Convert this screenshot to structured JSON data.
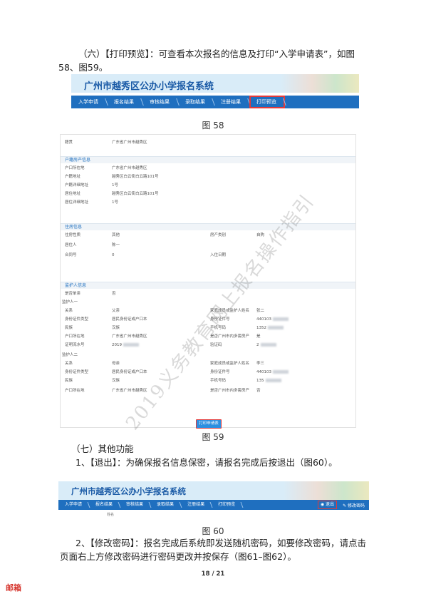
{
  "para1": "（六）【打印预览】：可查看本次报名的信息及打印“入学申请表”，如图58、图59。",
  "system_title": "广州市越秀区公办小学报名系统",
  "nav_items": [
    "入学申请",
    "报名结果",
    "审核结果",
    "录取结果",
    "注册结果",
    "打印预览"
  ],
  "fig58": "图 58",
  "form": {
    "top_row": {
      "label": "籍贯",
      "value": "广东省广州市越秀区"
    },
    "sections": [
      {
        "title": "户籍房产信息",
        "rows": [
          [
            "户口所在地",
            "广东省广州市越秀区",
            "",
            ""
          ],
          [
            "户籍地址",
            "越秀区白云街白云路101号",
            "",
            ""
          ],
          [
            "户籍详细地址",
            "1号",
            "",
            ""
          ],
          [
            "居住地址",
            "越秀区白云街白云路101号",
            "",
            ""
          ],
          [
            "居住详细地址",
            "1号",
            "",
            ""
          ]
        ]
      },
      {
        "title": "住房信息",
        "rows": [
          [
            "住房性质",
            "其他",
            "房产类别",
            "自购"
          ],
          [
            "居住人",
            "陈一",
            "",
            ""
          ],
          [
            "合同号",
            "0",
            "入住日期",
            ""
          ]
        ]
      },
      {
        "title": "监护人信息",
        "rows": [
          [
            "是否单亲",
            "否",
            "",
            ""
          ],
          [
            "监护人一",
            "",
            "",
            ""
          ],
          [
            "关系",
            "父亲",
            "家庭成员或监护人姓名",
            "张二"
          ],
          [
            "身份证件类型",
            "居民身份证或户口本",
            "身份证件号",
            "440103"
          ],
          [
            "民族",
            "汉族",
            "手机号码",
            "1352"
          ],
          [
            "户口所在地",
            "广东省广州市越秀区",
            "是否广州市内多套房产",
            "是"
          ],
          [
            "证明流水号",
            "2019",
            "验证码",
            "2"
          ],
          [
            "监护人二",
            "",
            "",
            ""
          ],
          [
            "关系",
            "母亲",
            "家庭成员或监护人姓名",
            "李三"
          ],
          [
            "身份证件类型",
            "居民身份证或户口本",
            "身份证件号",
            "440103"
          ],
          [
            "民族",
            "汉族",
            "手机号码",
            "135"
          ],
          [
            "户口所在地",
            "广东省广州市越秀区",
            "是否广州市内多套房产",
            "否"
          ]
        ]
      }
    ],
    "print_button": "打印申请表"
  },
  "watermark": "2019义务教育网上报名操作指引",
  "fig59": "图 59",
  "para2": "（七）其他功能",
  "para3": "1、【退出】：为确保报名信息保密，请报名完成后按退出（图60）。",
  "nav2_right": {
    "logout": "◉ 退出",
    "change_password": "✎ 修改密码"
  },
  "nav2_sub": "姓名",
  "fig60": "图 60",
  "para4": "2、【修改密码】：报名完成后系统即发送随机密码，如要修改密码，请点击页面右上方修改密码进行密码更改并按保存（图61–图62）。",
  "page_number": "18 / 21",
  "corner_logo": "邮箱"
}
